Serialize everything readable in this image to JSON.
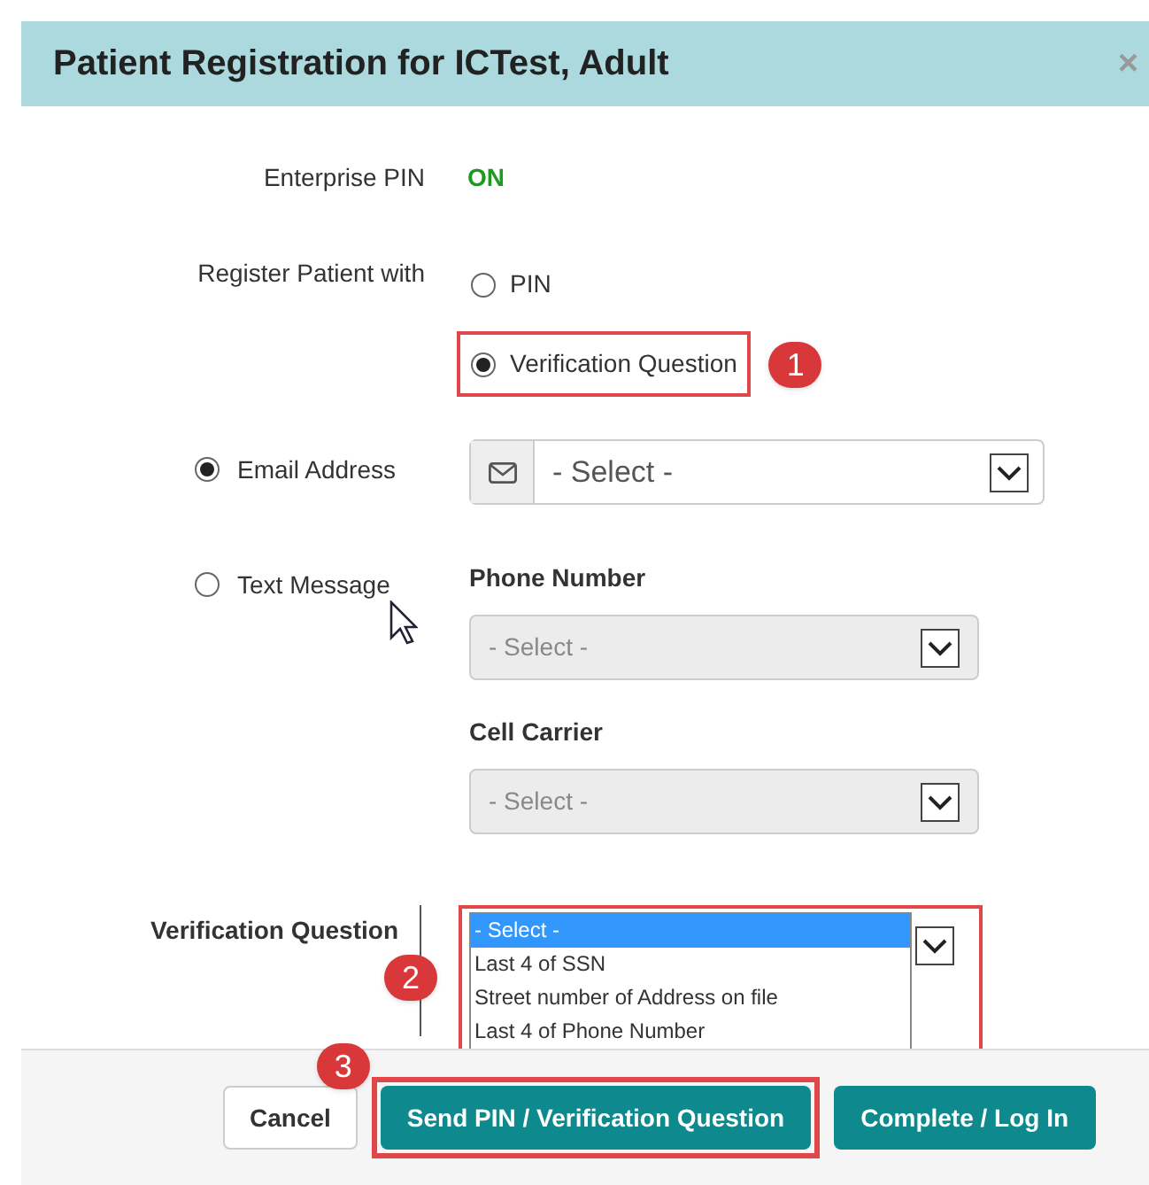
{
  "window": {
    "title": "Patient Registration for ICTest, Adult",
    "close": "×"
  },
  "enterprise_pin": {
    "label": "Enterprise PIN",
    "value": "ON"
  },
  "register_with": {
    "label": "Register Patient with",
    "callout": "1",
    "options": [
      {
        "label": "PIN",
        "selected": false
      },
      {
        "label": "Verification Question",
        "selected": true
      }
    ]
  },
  "delivery": [
    {
      "kind": "email",
      "label": "Email Address",
      "selected": true,
      "value": "- Select -"
    },
    {
      "kind": "text",
      "label": "Text Message",
      "selected": false,
      "fields": [
        {
          "label": "Phone Number",
          "value": "- Select -",
          "disabled": true
        },
        {
          "label": "Cell Carrier",
          "value": "- Select -",
          "disabled": true
        }
      ]
    }
  ],
  "verification_question": {
    "label": "Verification Question",
    "callout": "2",
    "options": [
      {
        "label": "- Select -",
        "selected": true
      },
      {
        "label": "Last 4 of SSN",
        "selected": false
      },
      {
        "label": "Street number of Address on file",
        "selected": false
      },
      {
        "label": "Last 4 of Phone Number",
        "selected": false
      }
    ]
  },
  "buttons": [
    {
      "label": "Cancel",
      "kind": "default"
    },
    {
      "label": "Send PIN / Verification Question",
      "kind": "primary",
      "callout": "3"
    },
    {
      "label": "Complete / Log In",
      "kind": "primary"
    }
  ]
}
